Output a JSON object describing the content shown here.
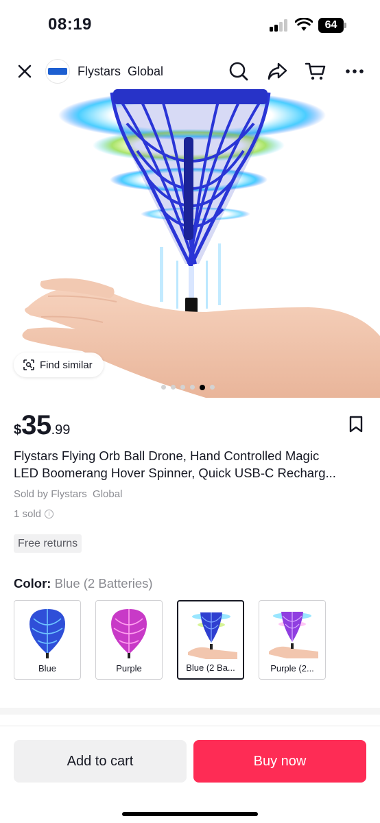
{
  "status_bar": {
    "time": "08:19",
    "battery": "64"
  },
  "header": {
    "close_icon": "close-icon",
    "shop_name": "Flystars  Global",
    "icons": [
      "search-icon",
      "share-icon",
      "cart-icon",
      "more-icon"
    ]
  },
  "hero": {
    "find_similar_label": "Find similar",
    "image_count": 6,
    "active_image_index": 5
  },
  "product": {
    "price_currency": "$",
    "price_main": "35",
    "price_decimal": ".99",
    "title_line1": "Flystars Flying Orb Ball Drone, Hand Controlled Magic",
    "title_line2": "LED Boomerang Hover Spinner, Quick USB-C Recharg...",
    "sold_by": "Sold by Flystars  Global",
    "sold_count": "1 sold",
    "free_returns": "Free returns"
  },
  "color": {
    "label": "Color:",
    "value": "Blue (2 Batteries)",
    "variants": [
      {
        "label": "Blue",
        "selected": false,
        "color": "#2f4fd8"
      },
      {
        "label": "Purple",
        "selected": false,
        "color": "#c83ac7"
      },
      {
        "label": "Blue (2 Ba...",
        "selected": true,
        "color": "#2f3fd0"
      },
      {
        "label": "Purple (2...",
        "selected": false,
        "color": "#8f3ee0"
      }
    ]
  },
  "actions": {
    "add_to_cart": "Add to cart",
    "buy_now": "Buy now"
  },
  "colors": {
    "accent": "#fe2c55",
    "text": "#161823",
    "muted": "#8a8b91"
  }
}
